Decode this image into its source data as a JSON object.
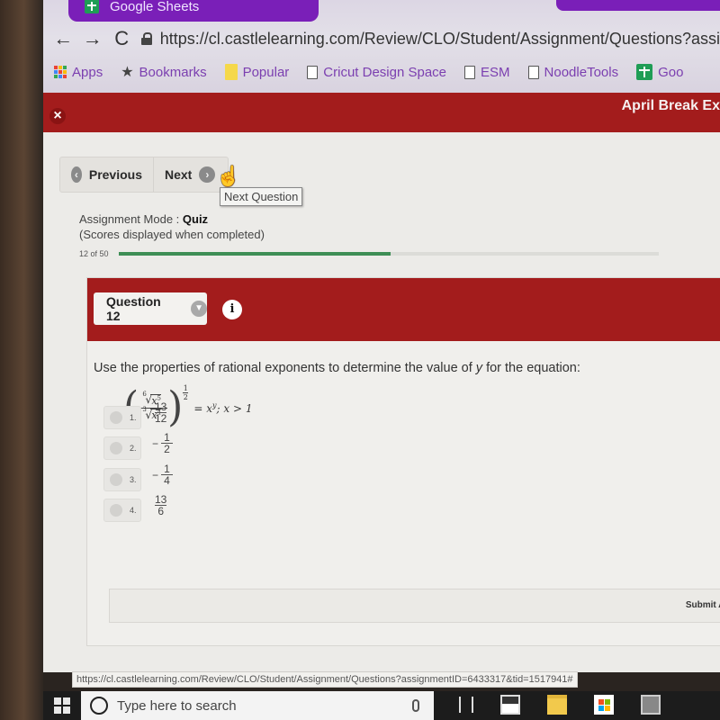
{
  "browser": {
    "active_tab": {
      "label": "Google Sheets",
      "icon": "google-sheets-icon"
    },
    "url": "https://cl.castlelearning.com/Review/CLO/Student/Assignment/Questions?assi",
    "nav": {
      "back": "←",
      "forward": "→",
      "reload": "C"
    },
    "bookmarks": [
      {
        "label": "Apps",
        "icon": "apps-icon"
      },
      {
        "label": "Bookmarks",
        "icon": "star-icon"
      },
      {
        "label": "Popular",
        "icon": "folder-icon"
      },
      {
        "label": "Cricut Design Space",
        "icon": "page-icon"
      },
      {
        "label": "ESM",
        "icon": "page-icon"
      },
      {
        "label": "NoodleTools",
        "icon": "page-icon"
      },
      {
        "label": "Goo",
        "icon": "google-classroom-icon"
      }
    ],
    "status_url": "https://cl.castlelearning.com/Review/CLO/Student/Assignment/Questions?assignmentID=6433317&tid=1517941#"
  },
  "header": {
    "close_label": "×",
    "title": "April Break Ex"
  },
  "navigation": {
    "previous_label": "Previous",
    "next_label": "Next",
    "tooltip": "Next Question"
  },
  "assignment": {
    "mode_label": "Assignment Mode : ",
    "mode_value": "Quiz",
    "scores_note": "(Scores displayed when completed)",
    "progress_text": "12 of 50",
    "progress_current": 12,
    "progress_total": 50
  },
  "question": {
    "selector_label": "Question 12",
    "info_label": "i",
    "prompt_before": "Use the properties of rational exponents to determine the value of ",
    "prompt_var": "y",
    "prompt_after": " for the equation:",
    "equation": {
      "numerator_index": "6",
      "numerator_radicand": "x",
      "numerator_power": "5",
      "denominator_index": "3",
      "denominator_radicand": "x",
      "denominator_power": "4",
      "outer_exp_num": "1",
      "outer_exp_den": "2",
      "rhs": "= x",
      "rhs_exp": "y",
      "condition": "; x > 1"
    },
    "choices": [
      {
        "number": "1.",
        "sign": "",
        "num": "13",
        "den": "12"
      },
      {
        "number": "2.",
        "sign": "−",
        "num": "1",
        "den": "2"
      },
      {
        "number": "3.",
        "sign": "−",
        "num": "1",
        "den": "4"
      },
      {
        "number": "4.",
        "sign": "",
        "num": "13",
        "den": "6"
      }
    ],
    "submit_label": "Submit Ans"
  },
  "taskbar": {
    "search_placeholder": "Type here to search"
  }
}
